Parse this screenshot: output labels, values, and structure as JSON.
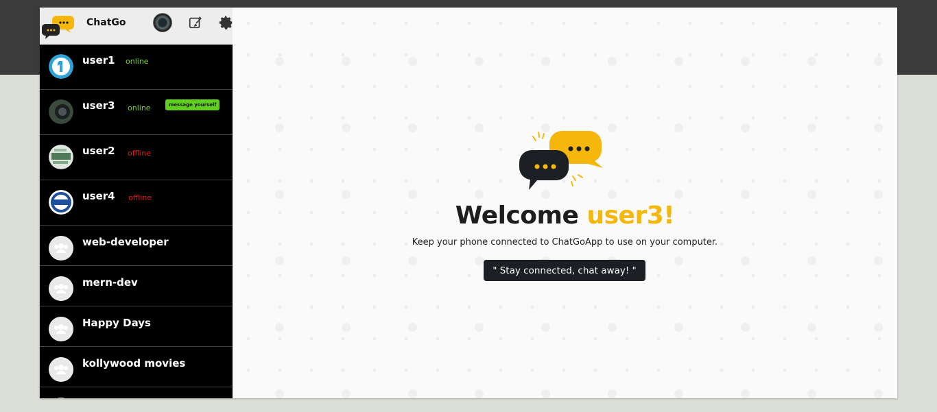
{
  "app": {
    "brand": "ChatGo"
  },
  "contacts": [
    {
      "name": "user1",
      "status": "online"
    },
    {
      "name": "user3",
      "status": "online",
      "badge": "message yourself"
    },
    {
      "name": "user2",
      "status": "offline"
    },
    {
      "name": "user4",
      "status": "offline"
    }
  ],
  "groups": [
    {
      "name": "web-developer"
    },
    {
      "name": "mern-dev"
    },
    {
      "name": "Happy Days"
    },
    {
      "name": "kollywood movies"
    }
  ],
  "welcome": {
    "prefix": "Welcome ",
    "user": "user3!",
    "subtitle": "Keep your phone connected to ChatGoApp to use on your computer.",
    "tagline": "\" Stay connected, chat away! \""
  },
  "colors": {
    "accent": "#f5b70b",
    "online": "#7ed321",
    "offline": "#e21b1b",
    "badge": "#5fd11c"
  },
  "icons": {
    "edit": "edit-icon",
    "settings": "gear-icon",
    "group": "group-icon"
  }
}
